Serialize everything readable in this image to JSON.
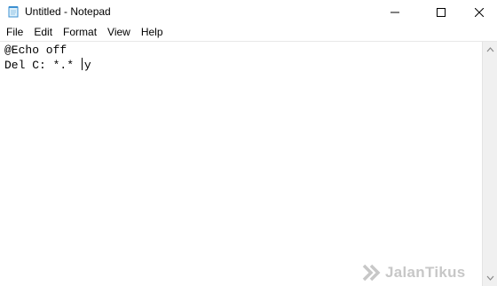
{
  "window": {
    "title": "Untitled - Notepad",
    "icon": "notepad-icon"
  },
  "controls": {
    "minimize_icon": "minimize-icon",
    "maximize_icon": "maximize-icon",
    "close_icon": "close-icon"
  },
  "menu": {
    "items": [
      "File",
      "Edit",
      "Format",
      "View",
      "Help"
    ]
  },
  "editor": {
    "line1": "@Echo off",
    "line2_before_caret": "Del C: *.* ",
    "line2_after_caret": "y"
  },
  "watermark": {
    "text": "JalanTikus"
  }
}
